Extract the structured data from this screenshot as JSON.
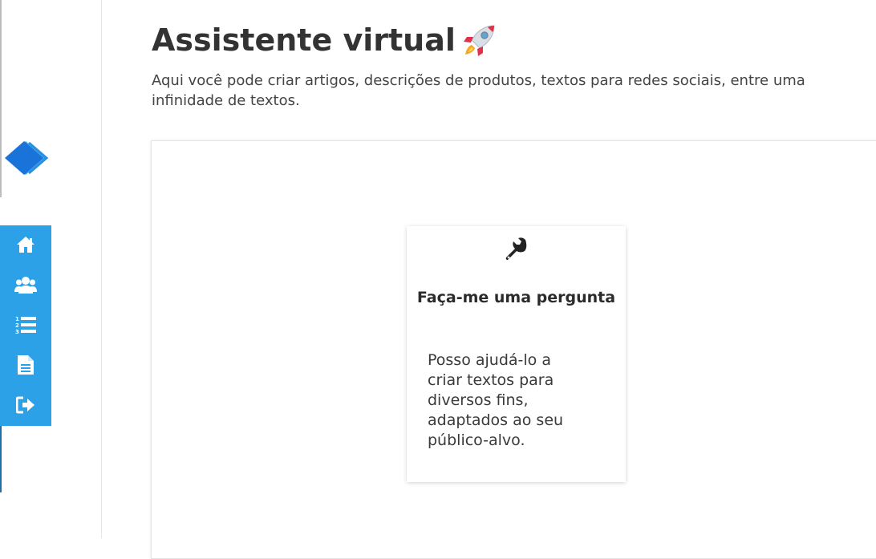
{
  "app": {
    "accent_color": "#2da1e8",
    "logo_icon": "diamond-logo-icon"
  },
  "sidebar": {
    "items": [
      {
        "icon": "home-icon",
        "name": "sidebar-item-home"
      },
      {
        "icon": "users-icon",
        "name": "sidebar-item-users"
      },
      {
        "icon": "numbered-list-icon",
        "name": "sidebar-item-list"
      },
      {
        "icon": "document-icon",
        "name": "sidebar-item-documents"
      },
      {
        "icon": "logout-icon",
        "name": "sidebar-item-logout"
      }
    ]
  },
  "header": {
    "title": "Assistente virtual",
    "title_icon": "rocket-icon",
    "subtitle": "Aqui você pode criar artigos, descrições de produtos, textos para redes sociais, entre uma infinidade de textos."
  },
  "main": {
    "cards": [
      {
        "icon": "wrench-icon",
        "title": "Faça-me uma pergunta",
        "description": "Posso ajudá-lo a criar textos para diversos fins, adaptados ao seu público-alvo."
      }
    ]
  }
}
